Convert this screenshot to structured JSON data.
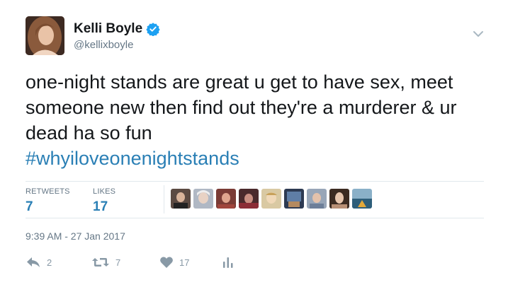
{
  "author": {
    "name": "Kelli Boyle",
    "handle": "@kellixboyle",
    "verified_icon": "verified-badge-icon",
    "avatar_icon": "profile-photo"
  },
  "tweet": {
    "text": "one-night stands are great u get to have sex, meet someone new then find out they're a murderer & ur dead ha so fun",
    "hashtag": "#whyiloveonenightstands"
  },
  "stats": {
    "retweets_label": "RETWEETS",
    "retweets_value": "7",
    "likes_label": "LIKES",
    "likes_value": "17"
  },
  "timestamp": "9:39 AM - 27 Jan 2017",
  "actions": {
    "reply_count": "2",
    "retweet_count": "7",
    "like_count": "17"
  },
  "colors": {
    "link": "#2a7fb5",
    "muted": "#657786",
    "verified": "#1da1f2"
  }
}
